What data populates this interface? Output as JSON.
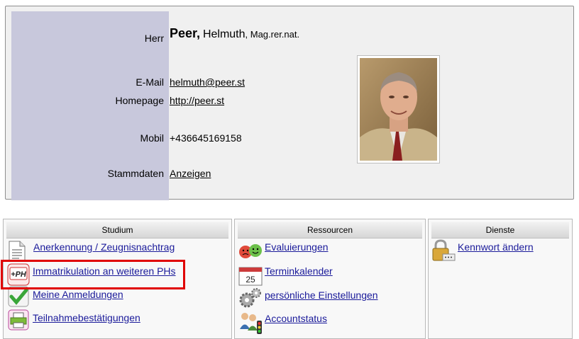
{
  "profile": {
    "salutation_label": "Herr",
    "last_name": "Peer,",
    "first_name": "Helmuth",
    "title_suffix": ", Mag.rer.nat.",
    "email_label": "E-Mail",
    "email": "helmuth@peer.st",
    "homepage_label": "Homepage",
    "homepage": "http://peer.st",
    "mobile_label": "Mobil",
    "mobile": "+436645169158",
    "stammdaten_label": "Stammdaten",
    "stammdaten_link": "Anzeigen"
  },
  "studium": {
    "title": "Studium",
    "items": [
      {
        "label": "Anerkennung / Zeugnisnachtrag",
        "icon": "document-icon"
      },
      {
        "label": "Immatrikulation an weiteren PHs",
        "icon": "ph-icon"
      },
      {
        "label": "Meine Anmeldungen",
        "icon": "checkmark-icon"
      },
      {
        "label": "Teilnahmebestätigungen",
        "icon": "printer-icon"
      }
    ]
  },
  "ressourcen": {
    "title": "Ressourcen",
    "items": [
      {
        "label": "Evaluierungen",
        "icon": "smiley-faces-icon"
      },
      {
        "label": "Terminkalender",
        "icon": "calendar-icon"
      },
      {
        "label": "persönliche Einstellungen",
        "icon": "gears-icon"
      },
      {
        "label": "Accountstatus",
        "icon": "users-traffic-light-icon"
      }
    ],
    "calendar_day": "25"
  },
  "dienste": {
    "title": "Dienste",
    "items": [
      {
        "label": "Kennwort ändern",
        "icon": "padlock-icon"
      }
    ]
  },
  "colors": {
    "label_column": "#c8c8dc",
    "link": "#1a1a9a",
    "highlight": "#e00000"
  }
}
